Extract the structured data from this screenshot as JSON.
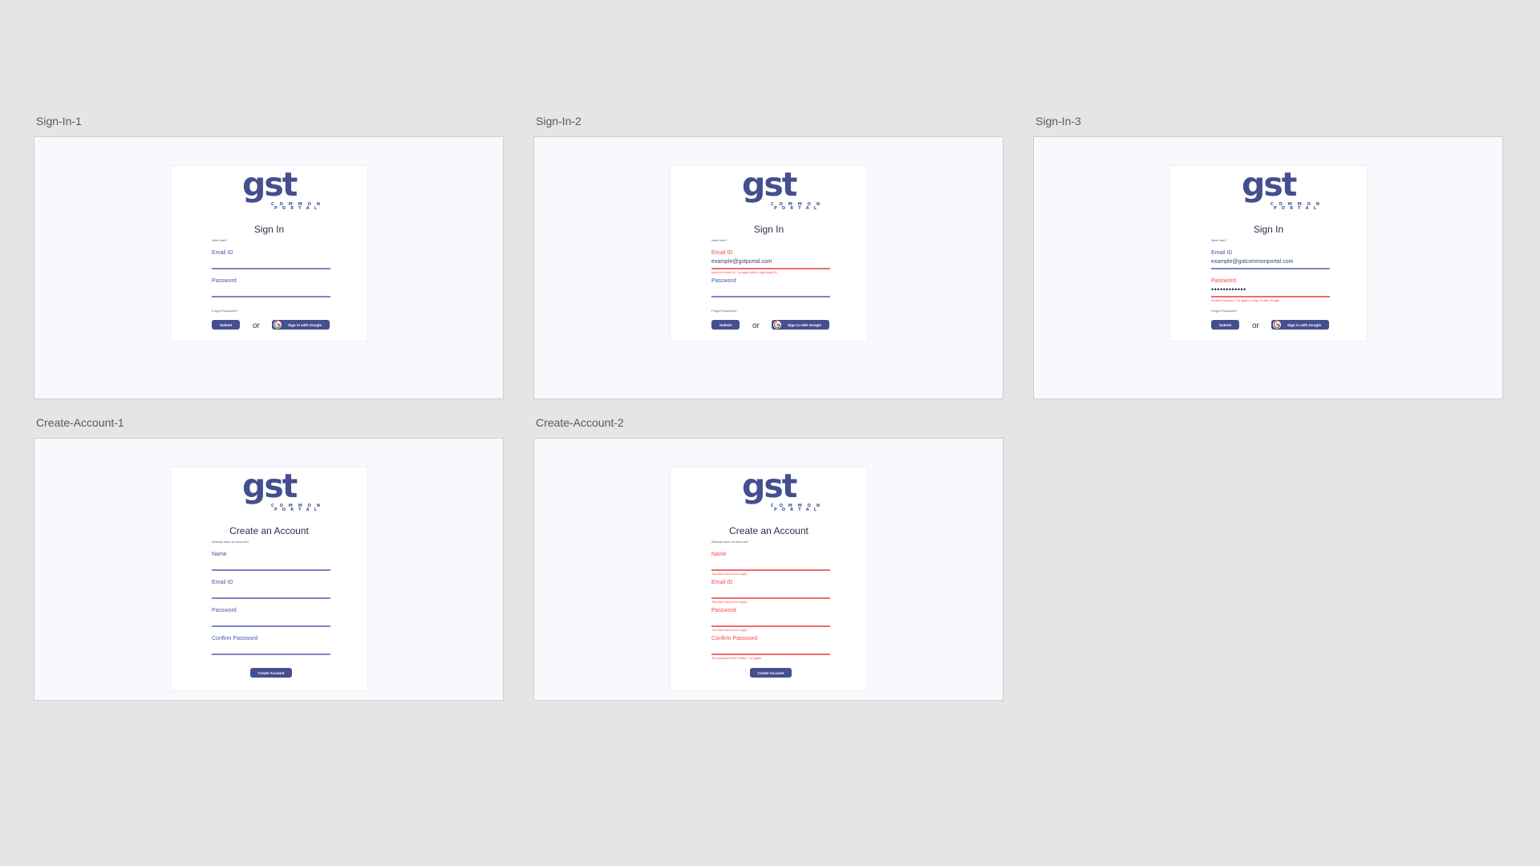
{
  "brand": {
    "logo_main": "gst",
    "logo_sub_top": "C O M M O N",
    "logo_sub_bottom": "P O R T A L",
    "accent_color": "#434f8e",
    "error_color": "#ef4a4a"
  },
  "frames": [
    {
      "label": "Sign-In-1",
      "title": "Sign In",
      "small_top": "New User?",
      "email_label": "Email ID",
      "email_value": "",
      "email_error": "",
      "password_label": "Password",
      "password_value": "",
      "password_error": "",
      "forgot": "Forgot Password?",
      "submit": "Submit",
      "or": "or",
      "google": "Sign in with Google"
    },
    {
      "label": "Sign-In-2",
      "title": "Sign In",
      "small_top": "New User?",
      "email_label": "Email ID",
      "email_value": "example@gstportal.com",
      "email_error": "Incorrect email ID. Try again with a right email ID",
      "password_label": "Password",
      "password_value": "",
      "password_error": "",
      "forgot": "Forgot Password?",
      "submit": "Submit",
      "or": "or",
      "google": "Sign in with Google"
    },
    {
      "label": "Sign-In-3",
      "title": "Sign In",
      "small_top": "New User?",
      "email_label": "Email ID",
      "email_value": "example@gstcommonportal.com",
      "email_error": "",
      "password_label": "Password",
      "password_value": "••••••••••••",
      "password_error": "Invalid Password. Try again or Sign-in with Google",
      "forgot": "Forgot Password?",
      "submit": "Submit",
      "or": "or",
      "google": "Sign in with Google"
    },
    {
      "label": "Create-Account-1",
      "title": "Create an Account",
      "small_top": "Already have an account?",
      "fields": [
        {
          "label": "Name",
          "error": ""
        },
        {
          "label": "Email ID",
          "error": ""
        },
        {
          "label": "Password",
          "error": ""
        },
        {
          "label": "Confirm Password",
          "error": ""
        }
      ],
      "create": "Create Account"
    },
    {
      "label": "Create-Account-2",
      "title": "Create an Account",
      "small_top": "Already have an account?",
      "fields": [
        {
          "label": "Name",
          "error": "This field cannot be empty"
        },
        {
          "label": "Email ID",
          "error": "This field cannot be empty"
        },
        {
          "label": "Password",
          "error": "This field cannot be empty"
        },
        {
          "label": "Confirm Password",
          "error": "The password don't match. Try again"
        }
      ],
      "create": "Create Account"
    }
  ]
}
